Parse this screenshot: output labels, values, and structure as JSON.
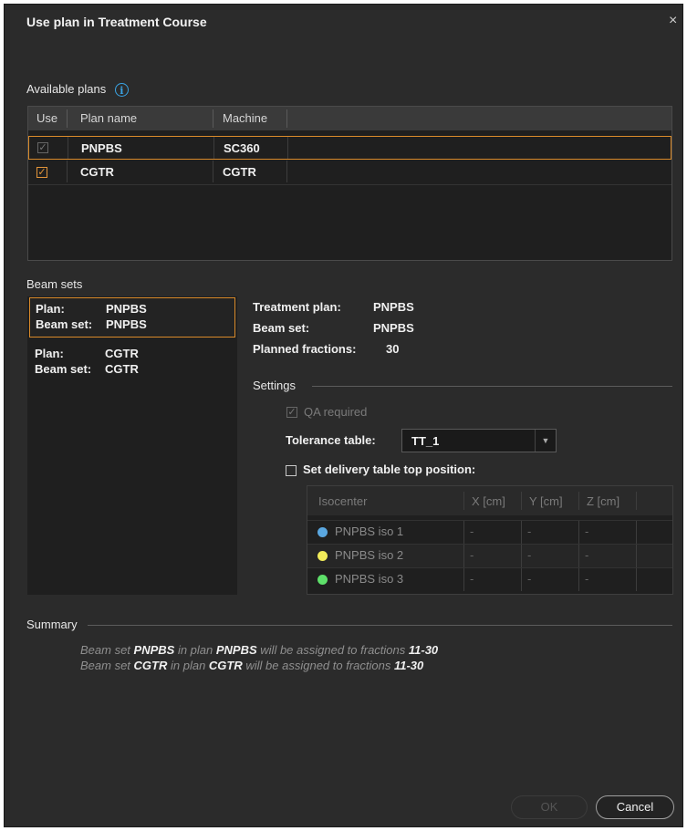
{
  "dialog": {
    "title": "Use plan in Treatment Course",
    "close_glyph": "×"
  },
  "available_plans": {
    "label": "Available plans",
    "info_glyph": "i",
    "columns": [
      "Use",
      "Plan name",
      "Machine"
    ],
    "rows": [
      {
        "use": true,
        "use_disabled": true,
        "plan_name": "PNPBS",
        "machine": "SC360",
        "selected": true
      },
      {
        "use": true,
        "use_disabled": false,
        "plan_name": "CGTR",
        "machine": "CGTR",
        "selected": false
      }
    ]
  },
  "beam_sets": {
    "label": "Beam sets",
    "plan_key": "Plan:",
    "beamset_key": "Beam set:",
    "items": [
      {
        "plan": "PNPBS",
        "beam_set": "PNPBS",
        "selected": true
      },
      {
        "plan": "CGTR",
        "beam_set": "CGTR",
        "selected": false
      }
    ]
  },
  "details": {
    "treatment_plan_label": "Treatment plan:",
    "treatment_plan_value": "PNPBS",
    "beam_set_label": "Beam set:",
    "beam_set_value": "PNPBS",
    "planned_fractions_label": "Planned fractions:",
    "planned_fractions_value": "30"
  },
  "settings": {
    "label": "Settings",
    "qa_required_label": "QA required",
    "qa_required_checked": true,
    "tolerance_table_label": "Tolerance table:",
    "tolerance_table_value": "TT_1",
    "set_delivery_label": "Set delivery table top position:",
    "set_delivery_checked": false
  },
  "isocenters": {
    "columns": [
      "Isocenter",
      "X [cm]",
      "Y [cm]",
      "Z [cm]"
    ],
    "rows": [
      {
        "name": "PNPBS iso 1",
        "color": "#5aa7e0",
        "x": "-",
        "y": "-",
        "z": "-"
      },
      {
        "name": "PNPBS iso 2",
        "color": "#f2ec5a",
        "x": "-",
        "y": "-",
        "z": "-"
      },
      {
        "name": "PNPBS iso 3",
        "color": "#5ee06a",
        "x": "-",
        "y": "-",
        "z": "-"
      }
    ]
  },
  "summary": {
    "label": "Summary",
    "lines": [
      {
        "t1": "Beam set ",
        "b1": "PNPBS",
        "t2": " in plan ",
        "b2": "PNPBS",
        "t3": " will be assigned to fractions ",
        "b3": "11-30"
      },
      {
        "t1": "Beam set ",
        "b1": "CGTR",
        "t2": " in plan ",
        "b2": "CGTR",
        "t3": " will be assigned to fractions ",
        "b3": "11-30"
      }
    ]
  },
  "buttons": {
    "ok_label": "OK",
    "cancel_label": "Cancel"
  },
  "colors": {
    "accent": "#d98a2a",
    "info": "#3aa3e3",
    "background": "#2b2b2b"
  }
}
